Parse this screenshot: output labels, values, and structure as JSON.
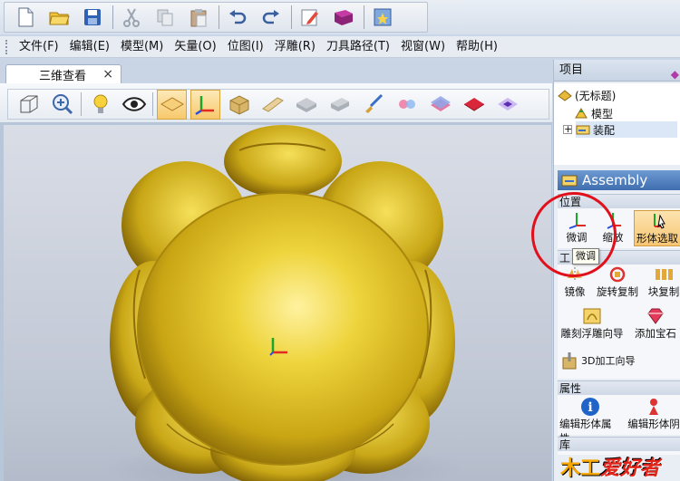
{
  "menubar": {
    "items": [
      "文件(F)",
      "编辑(E)",
      "模型(M)",
      "矢量(O)",
      "位图(I)",
      "浮雕(R)",
      "刀具路径(T)",
      "视窗(W)",
      "帮助(H)"
    ]
  },
  "document": {
    "tab_label": "三维查看",
    "tab_close": "×"
  },
  "panel": {
    "title": "项目",
    "tree": {
      "root": "(无标题)",
      "child_model": "模型",
      "child_assembly": "装配",
      "expander": "+"
    },
    "assembly_header": "Assembly",
    "sections": {
      "position": {
        "title": "位置",
        "tools": [
          "微调",
          "缩放",
          "形体选取"
        ]
      },
      "tools": {
        "title": "工",
        "tools": [
          "镜像",
          "旋转复制",
          "块复制",
          "雕刻浮雕向导",
          "添加宝石",
          "3D加工向导"
        ]
      },
      "properties": {
        "title": "属性",
        "tools": [
          "编辑形体属性",
          "编辑形体阴"
        ]
      },
      "library": {
        "title": "库"
      }
    }
  },
  "tooltip": "微调",
  "watermark": {
    "part1": "木工",
    "part2": "爱好者"
  },
  "colors": {
    "relief_gold": "#e8c828",
    "annotation_red": "#e1101a",
    "assembly_blue": "#3f6eb0",
    "active_orange": "#f6c673"
  }
}
